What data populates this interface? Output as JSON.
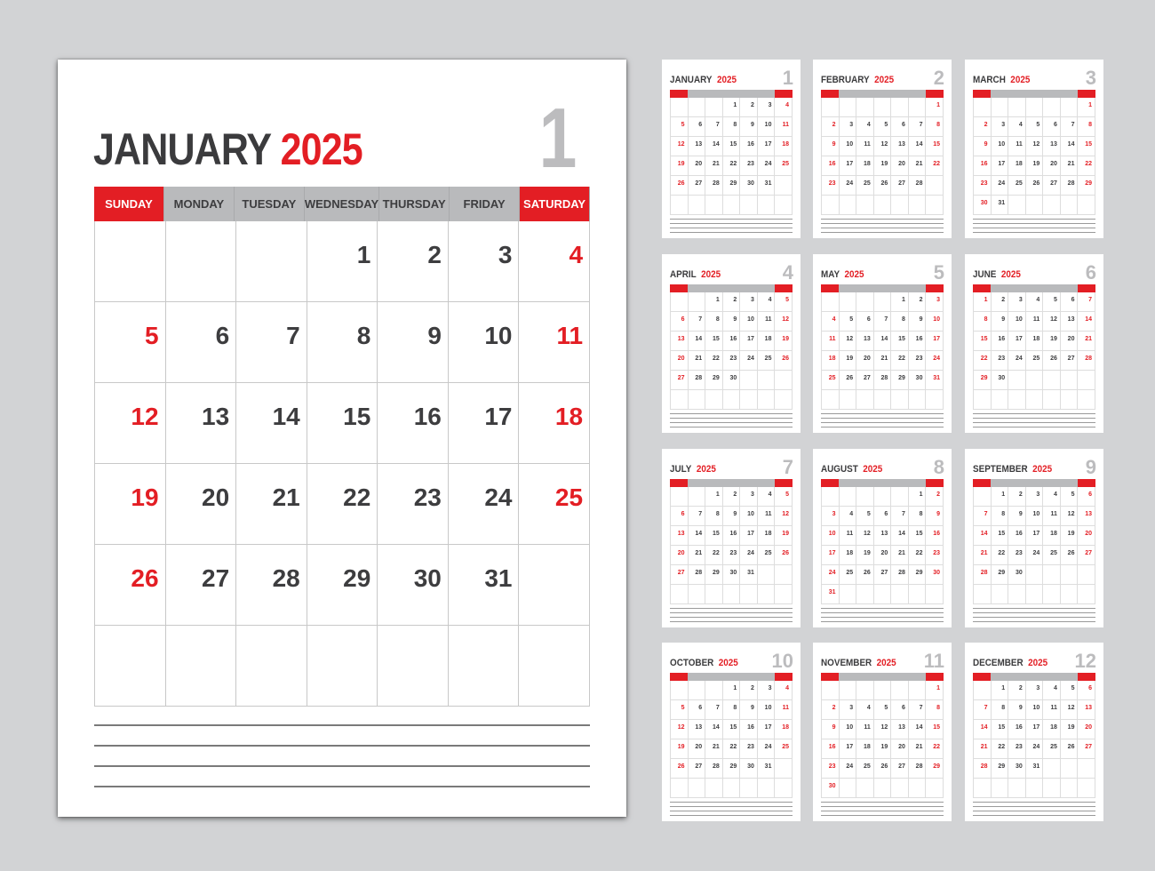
{
  "year": "2025",
  "weekdays": [
    "SUNDAY",
    "MONDAY",
    "TUESDAY",
    "WEDNESDAY",
    "THURSDAY",
    "FRIDAY",
    "SATURDAY"
  ],
  "colors": {
    "accent": "#e31e24",
    "header_gray": "#b9babc",
    "text_dark": "#3d3d3f",
    "number_gray": "#bcbcbe",
    "background": "#d2d3d5"
  },
  "featured": {
    "month": "JANUARY",
    "year": "2025",
    "number": "1",
    "weeks": [
      [
        "",
        "",
        "",
        "1",
        "2",
        "3",
        "4"
      ],
      [
        "5",
        "6",
        "7",
        "8",
        "9",
        "10",
        "11"
      ],
      [
        "12",
        "13",
        "14",
        "15",
        "16",
        "17",
        "18"
      ],
      [
        "19",
        "20",
        "21",
        "22",
        "23",
        "24",
        "25"
      ],
      [
        "26",
        "27",
        "28",
        "29",
        "30",
        "31",
        ""
      ],
      [
        "",
        "",
        "",
        "",
        "",
        "",
        ""
      ]
    ],
    "note_lines": 4
  },
  "months": [
    {
      "name": "JANUARY",
      "number": "1",
      "start": 3,
      "days": 31
    },
    {
      "name": "FEBRUARY",
      "number": "2",
      "start": 6,
      "days": 28
    },
    {
      "name": "MARCH",
      "number": "3",
      "start": 6,
      "days": 31
    },
    {
      "name": "APRIL",
      "number": "4",
      "start": 2,
      "days": 30
    },
    {
      "name": "MAY",
      "number": "5",
      "start": 4,
      "days": 31
    },
    {
      "name": "JUNE",
      "number": "6",
      "start": 0,
      "days": 30
    },
    {
      "name": "JULY",
      "number": "7",
      "start": 2,
      "days": 31
    },
    {
      "name": "AUGUST",
      "number": "8",
      "start": 5,
      "days": 31
    },
    {
      "name": "SEPTEMBER",
      "number": "9",
      "start": 1,
      "days": 30
    },
    {
      "name": "OCTOBER",
      "number": "10",
      "start": 3,
      "days": 31
    },
    {
      "name": "NOVEMBER",
      "number": "11",
      "start": 6,
      "days": 30
    },
    {
      "name": "DECEMBER",
      "number": "12",
      "start": 1,
      "days": 31
    }
  ]
}
